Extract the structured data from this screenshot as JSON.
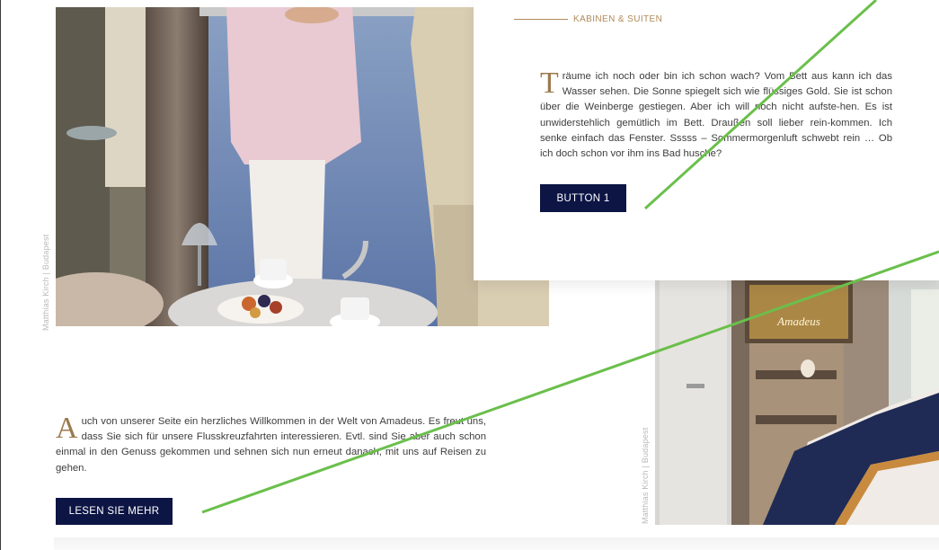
{
  "section": {
    "eyebrow": "KABINEN & SUITEN"
  },
  "card_top": {
    "dropcap": "T",
    "text": "räume ich noch oder bin ich schon wach? Vom Bett aus kann ich das Wasser sehen. Die Sonne spiegelt sich wie flüssiges Gold. Sie ist schon über die Weinberge gestiegen. Aber ich will noch nicht aufste-hen. Es ist unwiderstehlich gemütlich im Bett. Draußen soll lieber rein-kommen. Ich senke einfach das Fenster. Sssss – Sommermorgenluft schwebt rein … Ob ich doch schon vor ihm ins Bad husche?",
    "button_label": "BUTTON 1"
  },
  "card_bottom": {
    "dropcap": "A",
    "text": "uch von unserer Seite ein herzliches Willkommen in der Welt von Amadeus. Es freut uns, dass Sie sich für unsere Flusskreuzfahrten interessieren. Evtl. sind Sie aber auch schon einmal in den Genuss gekommen und sehnen sich nun erneut danach, mit uns auf Reisen zu gehen.",
    "button_label": "LESEN SIE MEHR"
  },
  "photos": {
    "left_credit": "Matthias Kirch | Budapest",
    "right_credit": "Matthias Kirch | Budapest",
    "right_sign": "Amadeus"
  },
  "colors": {
    "accent": "#b08a5a",
    "button": "#0d1545",
    "annotation_arrow": "#6abf4b"
  }
}
